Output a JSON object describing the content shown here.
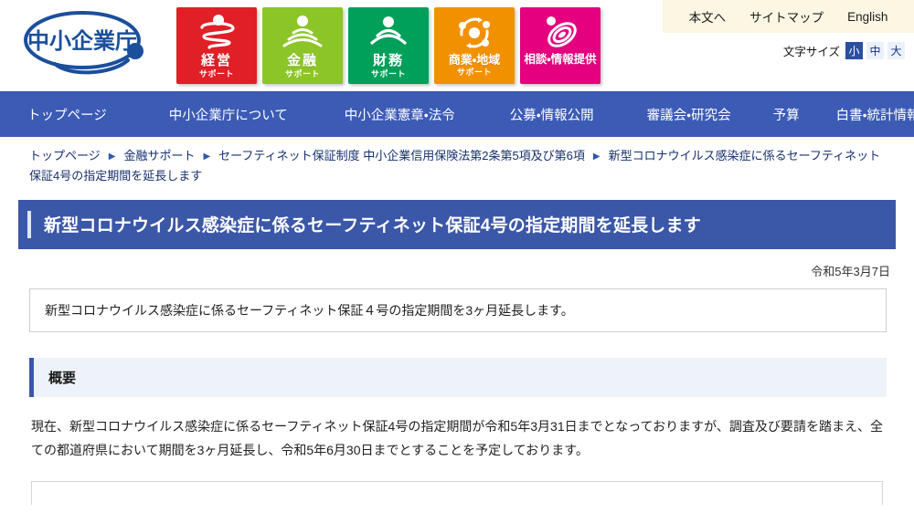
{
  "header": {
    "logo_text": "中小企業庁",
    "logo_name": "chusho-kigyocho-logo",
    "utility_links": [
      {
        "label": "本文へ",
        "name": "skip-to-content-link"
      },
      {
        "label": "サイトマップ",
        "name": "sitemap-link"
      },
      {
        "label": "English",
        "name": "english-link"
      }
    ],
    "font_size": {
      "label": "文字サイズ",
      "options": [
        {
          "label": "小",
          "selected": true
        },
        {
          "label": "中",
          "selected": false
        },
        {
          "label": "大",
          "selected": false
        }
      ]
    },
    "category_buttons": [
      {
        "main": "経営",
        "sub": "サポート",
        "color": "#e01f26",
        "icon": "spiral-icon"
      },
      {
        "main": "金融",
        "sub": "サポート",
        "color": "#8cc527",
        "icon": "wave-arc-icon"
      },
      {
        "main": "財務",
        "sub": "サポート",
        "color": "#00a05a",
        "icon": "wifi-arc-icon"
      },
      {
        "main": "商業・地域",
        "sub": "サポート",
        "color": "#f29100",
        "icon": "circular-arrows-icon"
      },
      {
        "main": "相談・情報提供",
        "sub": "",
        "color": "#e4007f",
        "icon": "swirl-ellipse-icon"
      }
    ]
  },
  "mainnav": {
    "background": "#3c5bb5",
    "items": [
      "トップページ",
      "中小企業庁について",
      "中小企業憲章・法令",
      "公募・情報公開",
      "審議会・研究会",
      "予算",
      "白書・統計情報"
    ]
  },
  "breadcrumb": {
    "separator": "▶",
    "items": [
      "トップページ",
      "金融サポート",
      "セーフティネット保証制度 中小企業信用保険法第2条第5項及び第6項",
      "新型コロナウイルス感染症に係るセーフティネット保証4号の指定期間を延長します"
    ]
  },
  "main": {
    "page_title": "新型コロナウイルス感染症に係るセーフティネット保証4号の指定期間を延長します",
    "date": "令和5年3月7日",
    "lead": "新型コロナウイルス感染症に係るセーフティネット保証４号の指定期間を3ヶ月延長します。",
    "section_heading": "概要",
    "body_paragraph": "現在、新型コロナウイルス感染症に係るセーフティネット保証4号の指定期間が令和5年3月31日までとなっておりますが、調査及び要請を踏まえ、全ての都道府県において期間を3ヶ月延長し、令和5年6月30日までとすることを予定しております。"
  },
  "colors": {
    "nav_blue": "#3c5bb5",
    "title_blue": "#3b57a8",
    "utility_cream": "#fdf6e3",
    "breadcrumb_link": "#16306e",
    "section_bg": "#eef3fa"
  }
}
